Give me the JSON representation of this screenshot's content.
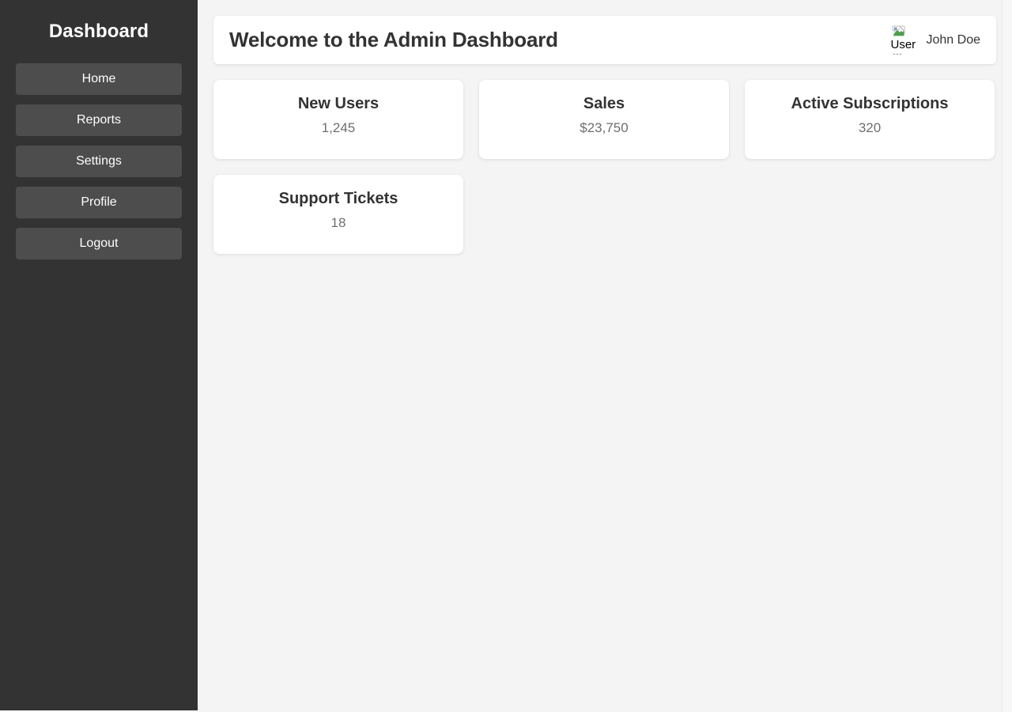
{
  "sidebar": {
    "title": "Dashboard",
    "items": [
      {
        "label": "Home",
        "name": "home"
      },
      {
        "label": "Reports",
        "name": "reports"
      },
      {
        "label": "Settings",
        "name": "settings"
      },
      {
        "label": "Profile",
        "name": "profile"
      },
      {
        "label": "Logout",
        "name": "logout"
      }
    ],
    "background_color": "#333333",
    "item_background_color": "#4d4d4d",
    "text_color": "#ffffff"
  },
  "topbar": {
    "page_title": "Welcome to the Admin Dashboard",
    "user_name": "John Doe",
    "avatar_alt": "User",
    "avatar_state": "broken-image"
  },
  "cards": [
    {
      "title": "New Users",
      "value": "1,245"
    },
    {
      "title": "Sales",
      "value": "$23,750"
    },
    {
      "title": "Active Subscriptions",
      "value": "320"
    },
    {
      "title": "Support Tickets",
      "value": "18"
    }
  ],
  "theme": {
    "content_background": "#f4f4f4",
    "card_background": "#ffffff",
    "title_color": "#333333",
    "value_color": "#6e6e6e"
  }
}
